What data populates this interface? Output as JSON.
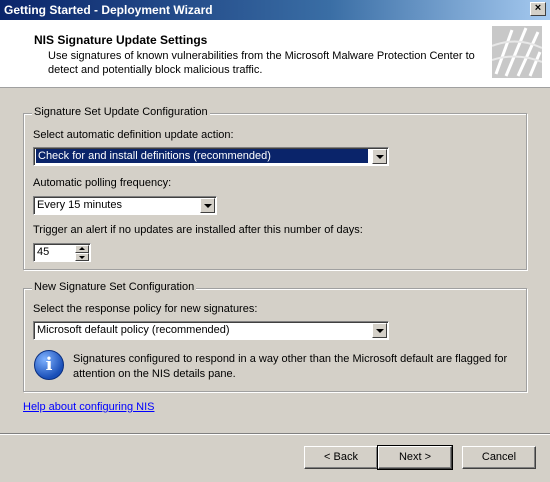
{
  "window": {
    "title": "Getting Started - Deployment Wizard",
    "close_glyph": "×"
  },
  "header": {
    "title": "NIS Signature Update Settings",
    "description": "Use signatures of known vulnerabilities from the Microsoft Malware Protection Center to detect and potentially block malicious traffic."
  },
  "signature_update": {
    "legend": "Signature Set Update Configuration",
    "action_label": "Select automatic definition update action:",
    "action_value": "Check for and install definitions (recommended)",
    "polling_label": "Automatic polling frequency:",
    "polling_value": "Every 15 minutes",
    "alert_label": "Trigger an alert if no updates are installed after this number of days:",
    "alert_days": "45"
  },
  "new_signature": {
    "legend": "New Signature Set Configuration",
    "policy_label": "Select the response policy for new signatures:",
    "policy_value": "Microsoft default policy (recommended)",
    "info_glyph": "i",
    "info_text": "Signatures configured to respond in a way other than the Microsoft default are flagged for attention on the NIS details pane."
  },
  "help_link": "Help about configuring NIS",
  "buttons": {
    "back": "< Back",
    "next": "Next >",
    "cancel": "Cancel"
  }
}
